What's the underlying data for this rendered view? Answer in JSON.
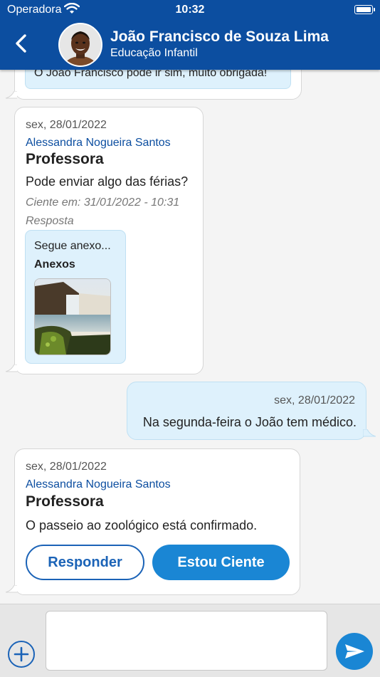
{
  "status": {
    "carrier": "Operadora",
    "time": "10:32"
  },
  "header": {
    "name": "João Francisco de Souza Lima",
    "subtitle": "Educação Infantil"
  },
  "messages": [
    {
      "type": "outgoing-partial",
      "text": "O João Francisco pode ir sim, muito obrigada!"
    },
    {
      "type": "incoming",
      "date": "sex, 28/01/2022",
      "sender": "Alessandra Nogueira Santos",
      "role": "Professora",
      "text": "Pode enviar algo das férias?",
      "ack": "Ciente em: 31/01/2022 - 10:31",
      "reply_label": "Resposta",
      "reply": {
        "text": "Segue anexo...",
        "attachments_label": "Anexos"
      }
    },
    {
      "type": "outgoing",
      "date": "sex, 28/01/2022",
      "text": "Na segunda-feira o João tem médico."
    },
    {
      "type": "incoming",
      "date": "sex, 28/01/2022",
      "sender": "Alessandra Nogueira Santos",
      "role": "Professora",
      "text": "O passeio ao zoológico está confirmado.",
      "actions": {
        "reply": "Responder",
        "acknowledge": "Estou Ciente"
      }
    }
  ],
  "composer": {
    "value": ""
  },
  "colors": {
    "brand": "#0c4ea0",
    "accent": "#1a86d4",
    "bubble_out": "#def1fc"
  }
}
